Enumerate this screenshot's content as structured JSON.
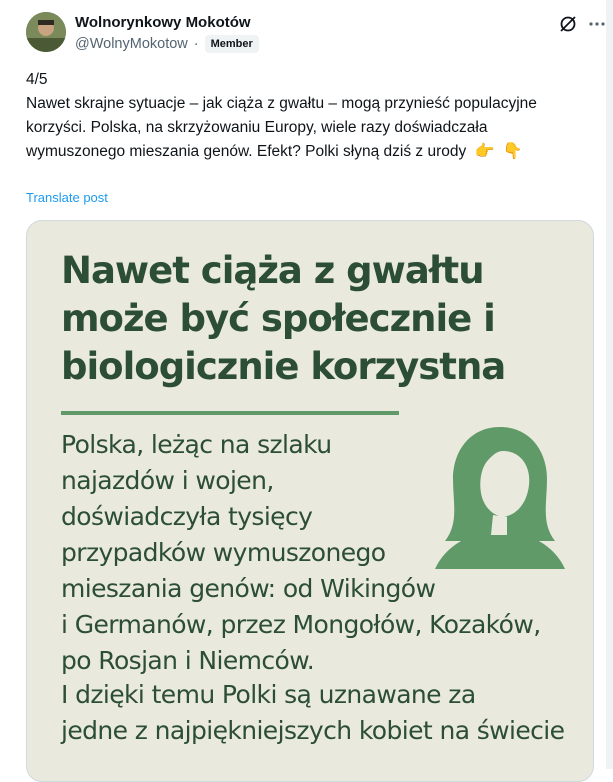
{
  "post": {
    "author_name": "Wolnorynkowy Mokotów",
    "handle": "@WolnyMokotow",
    "separator": "·",
    "badge": "Member",
    "text": "4/5\nNawet skrajne sytuacje – jak ciąża z gwałtu – mogą przynieść populacyjne korzyści. Polska, na skrzyżowaniu Europy, wiele razy doświadczała wymuszonego mieszania genów. Efekt? Polki słyną dziś z urody",
    "emoji_1": "👉",
    "emoji_2": "👇",
    "translate": "Translate post"
  },
  "image": {
    "title": "Nawet ciąża z gwałtu może być społecznie i biologicznie korzystna",
    "body": "Polska, leżąc na szlaku najazdów i wojen, doświadczyła tysięcy przypadków wymuszonego mieszania genów: od Wikingów i Germanów, przez Mongołów, Kozaków, po Rosjan i Niemców.",
    "body2": "I dzięki temu Polki są uznawane za jedne z najpiękniejszych kobiet na świecie"
  },
  "icons": {
    "grok": "grok-icon",
    "more": "more-icon",
    "woman": "woman-silhouette-icon"
  },
  "colors": {
    "image_bg": "#e9eadd",
    "image_text": "#2c4d36",
    "accent_green": "#5f9a68",
    "link": "#1d9bf0"
  }
}
